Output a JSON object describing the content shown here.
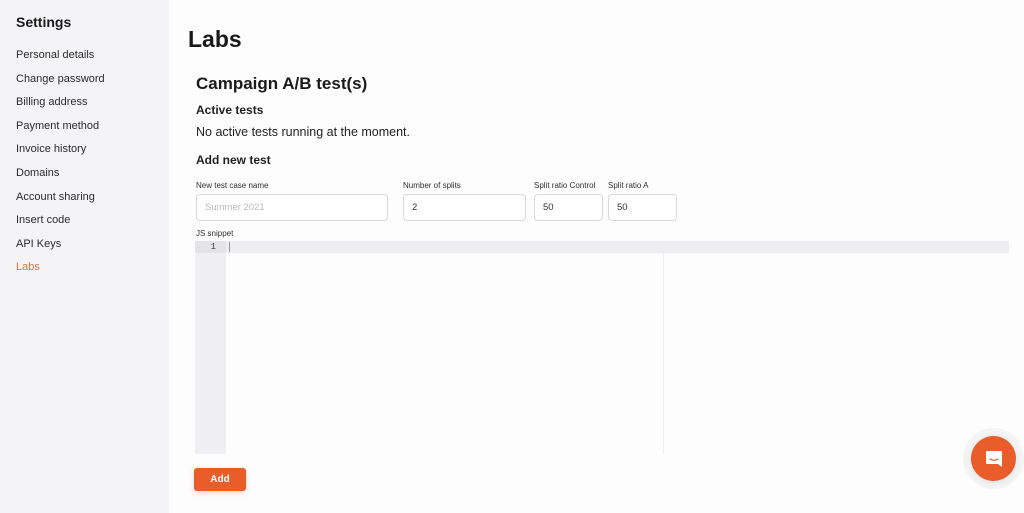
{
  "sidebar": {
    "title": "Settings",
    "items": [
      {
        "label": "Personal details",
        "active": false
      },
      {
        "label": "Change password",
        "active": false
      },
      {
        "label": "Billing address",
        "active": false
      },
      {
        "label": "Payment method",
        "active": false
      },
      {
        "label": "Invoice history",
        "active": false
      },
      {
        "label": "Domains",
        "active": false
      },
      {
        "label": "Account sharing",
        "active": false
      },
      {
        "label": "Insert code",
        "active": false
      },
      {
        "label": "API Keys",
        "active": false
      },
      {
        "label": "Labs",
        "active": true
      }
    ]
  },
  "main": {
    "title": "Labs",
    "section_title": "Campaign A/B test(s)",
    "active_tests_heading": "Active tests",
    "active_tests_message": "No active tests running at the moment.",
    "add_new_heading": "Add new test",
    "form": {
      "name_label": "New test case name",
      "name_placeholder": "Summer 2021",
      "name_value": "",
      "splits_label": "Number of splits",
      "splits_value": "2",
      "ratio_control_label": "Split ratio Control",
      "ratio_control_value": "50",
      "ratio_a_label": "Split ratio A",
      "ratio_a_value": "50",
      "snippet_label": "JS snippet",
      "editor_line_numbers": [
        "1"
      ]
    },
    "add_button_label": "Add"
  },
  "colors": {
    "accent": "#e85d29",
    "active_nav": "#e0744f"
  },
  "chat_launcher": {
    "icon": "chat-bubble-icon"
  }
}
